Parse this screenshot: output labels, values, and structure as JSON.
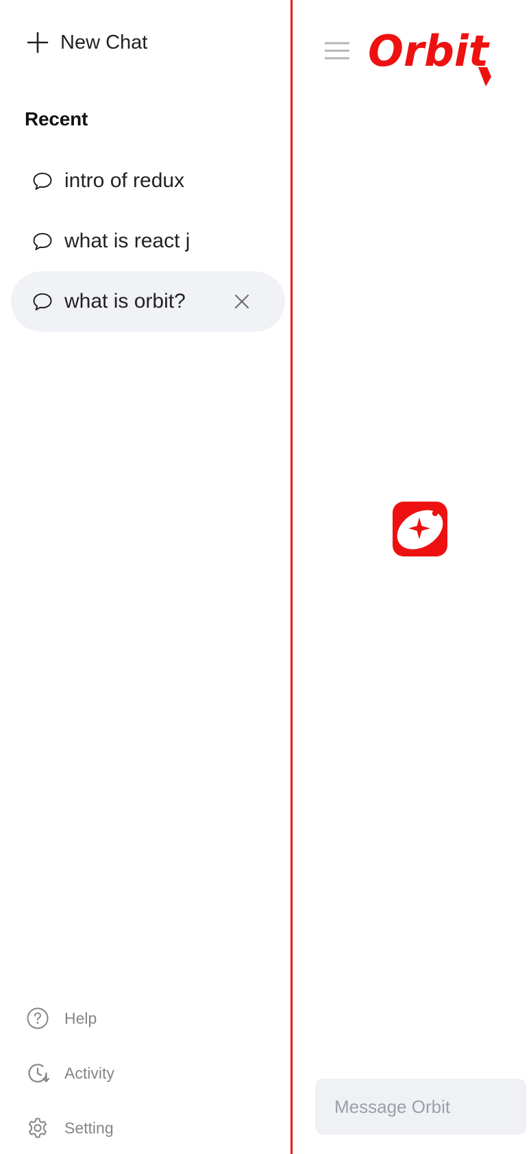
{
  "sidebar": {
    "new_chat_label": "New Chat",
    "recent_heading": "Recent",
    "history": [
      {
        "title": "intro of redux",
        "active": false
      },
      {
        "title": "what is react j",
        "active": false
      },
      {
        "title": "what is orbit?",
        "active": true
      }
    ],
    "footer": [
      {
        "label": "Help",
        "icon": "help-circle-icon"
      },
      {
        "label": "Activity",
        "icon": "activity-history-icon"
      },
      {
        "label": "Setting",
        "icon": "gear-icon"
      }
    ]
  },
  "header": {
    "brand_name": "Orbit"
  },
  "composer": {
    "placeholder": "Message Orbit"
  },
  "colors": {
    "brand": "#ee1111",
    "active_item_bg": "#f0f2f6",
    "composer_bg": "#eff1f5"
  },
  "icons": {
    "new_chat": "plus-icon",
    "history_item": "chat-bubble-icon",
    "delete": "close-icon",
    "menu": "hamburger-menu-icon",
    "emblem": "orbit-sparkle-logo"
  }
}
